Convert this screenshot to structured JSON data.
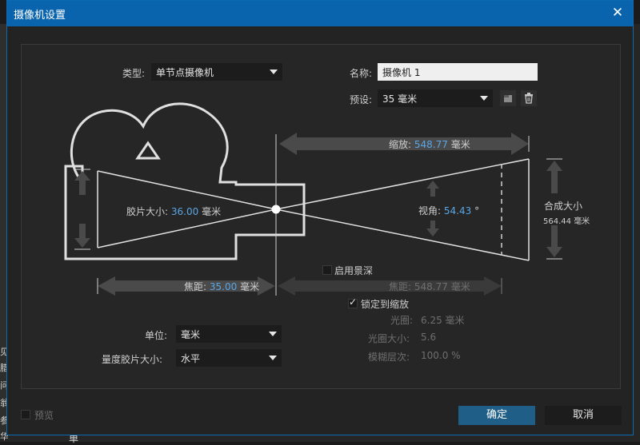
{
  "window": {
    "title": "摄像机设置",
    "close_symbol": "✕"
  },
  "type": {
    "label": "类型:",
    "value": "单节点摄像机"
  },
  "name": {
    "label": "名称:",
    "value": "摄像机 1"
  },
  "preset": {
    "label": "预设:",
    "value": "35 毫米"
  },
  "zoom": {
    "label": "缩放:",
    "value": "548.77",
    "unit": "毫米"
  },
  "film_size": {
    "label": "胶片大小:",
    "value": "36.00",
    "unit": "毫米"
  },
  "angle": {
    "label": "视角:",
    "value": "54.43",
    "unit": "°"
  },
  "comp_size": {
    "label": "合成大小",
    "value": "564.44",
    "unit": "毫米"
  },
  "focal_length": {
    "label": "焦距:",
    "value": "35.00",
    "unit": "毫米"
  },
  "dof": {
    "label": "启用景深",
    "checked": false
  },
  "focus_distance": {
    "label": "焦距:",
    "value": "548.77",
    "unit": "毫米"
  },
  "lock_zoom": {
    "label": "锁定到缩放",
    "checked": true
  },
  "aperture": {
    "label": "光圈:",
    "value": "6.25 毫米"
  },
  "fstop": {
    "label": "光圈大小:",
    "value": "5.6"
  },
  "blur": {
    "label": "模糊层次:",
    "value": "100.0 %"
  },
  "units": {
    "label": "单位:",
    "value": "毫米"
  },
  "measure": {
    "label": "量度胶片大小:",
    "value": "水平"
  },
  "preview": {
    "label": "预览",
    "checked": false
  },
  "buttons": {
    "ok": "确定",
    "cancel": "取消"
  },
  "background": {
    "left_chars": [
      "见",
      "腊",
      "问",
      "翁",
      "参",
      "华"
    ],
    "bottom_char": "单"
  },
  "colors": {
    "title_bar": "#0a64ad",
    "accent_value": "#5aa6e6",
    "ok_button": "#1f5e86"
  },
  "icons": [
    "trash-icon",
    "save-preset-icon",
    "camera-diagram-icon"
  ]
}
